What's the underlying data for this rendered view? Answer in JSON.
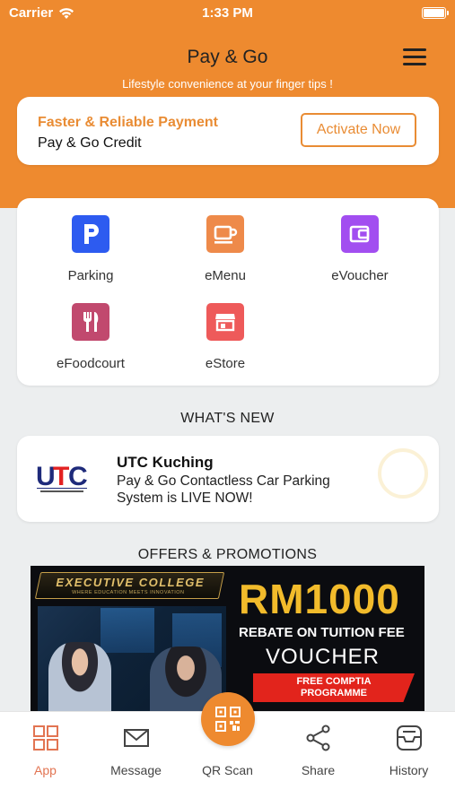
{
  "status_bar": {
    "carrier": "Carrier",
    "time": "1:33 PM"
  },
  "header": {
    "title": "Pay & Go",
    "subtitle": "Lifestyle convenience at your finger tips !",
    "menu_icon": "hamburger-menu-icon"
  },
  "credit_card": {
    "headline": "Faster & Reliable Payment",
    "label": "Pay & Go Credit",
    "button": "Activate Now"
  },
  "services": [
    {
      "label": "Parking",
      "icon": "parking-icon",
      "color": "#2d5bf0"
    },
    {
      "label": "eMenu",
      "icon": "coffee-cup-icon",
      "color": "#ee8a4a"
    },
    {
      "label": "eVoucher",
      "icon": "wallet-icon",
      "color": "#a24ef0"
    },
    {
      "label": "eFoodcourt",
      "icon": "fork-knife-icon",
      "color": "#c1496e"
    },
    {
      "label": "eStore",
      "icon": "store-icon",
      "color": "#ee5a5a"
    }
  ],
  "whats_new": {
    "section_title": "WHAT'S NEW",
    "logo_text": "UTC",
    "logo_tagline": "PUSAT TRANSFORMASI BANDAR",
    "title": "UTC Kuching",
    "body": "Pay & Go Contactless Car Parking System is LIVE NOW!"
  },
  "offers": {
    "section_title": "OFFERS & PROMOTIONS",
    "banner": {
      "college": "EXECUTIVE COLLEGE",
      "tagline": "WHERE EDUCATION MEETS INNOVATION",
      "amount": "RM1000",
      "rebate": "REBATE ON TUITION FEE",
      "voucher": "VOUCHER",
      "free_line1": "FREE COMPTIA",
      "free_line2": "PROGRAMME"
    }
  },
  "tab_bar": {
    "app": "App",
    "message": "Message",
    "qr_scan": "QR Scan",
    "share": "Share",
    "history": "History"
  },
  "colors": {
    "brand": "#ee8a2f",
    "active_tab": "#e27452"
  }
}
